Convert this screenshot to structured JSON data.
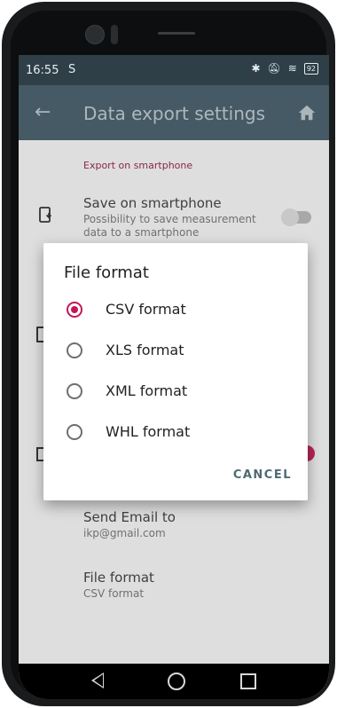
{
  "status_bar": {
    "time": "16:55",
    "app_badge": "S",
    "battery": "92"
  },
  "toolbar": {
    "back_icon": "arrow-left-icon",
    "title": "Data export settings",
    "home_icon": "home-icon"
  },
  "settings": {
    "section_export_smartphone": "Export on smartphone",
    "save_on_smartphone": {
      "title": "Save on smartphone",
      "subtitle": "Possibility to save measurement data to a smartphone"
    },
    "send_email_to": {
      "title": "Send Email to",
      "value": "ikp@gmail.com"
    },
    "file_format": {
      "title": "File format",
      "value": "CSV format"
    }
  },
  "dialog": {
    "title": "File format",
    "options": [
      {
        "label": "CSV format",
        "checked": true
      },
      {
        "label": "XLS format",
        "checked": false
      },
      {
        "label": "XML format",
        "checked": false
      },
      {
        "label": "WHL format",
        "checked": false
      }
    ],
    "cancel_label": "CANCEL"
  },
  "colors": {
    "accent": "#c2185b",
    "toolbar": "#455a64",
    "status_bar": "#2e3f48"
  }
}
